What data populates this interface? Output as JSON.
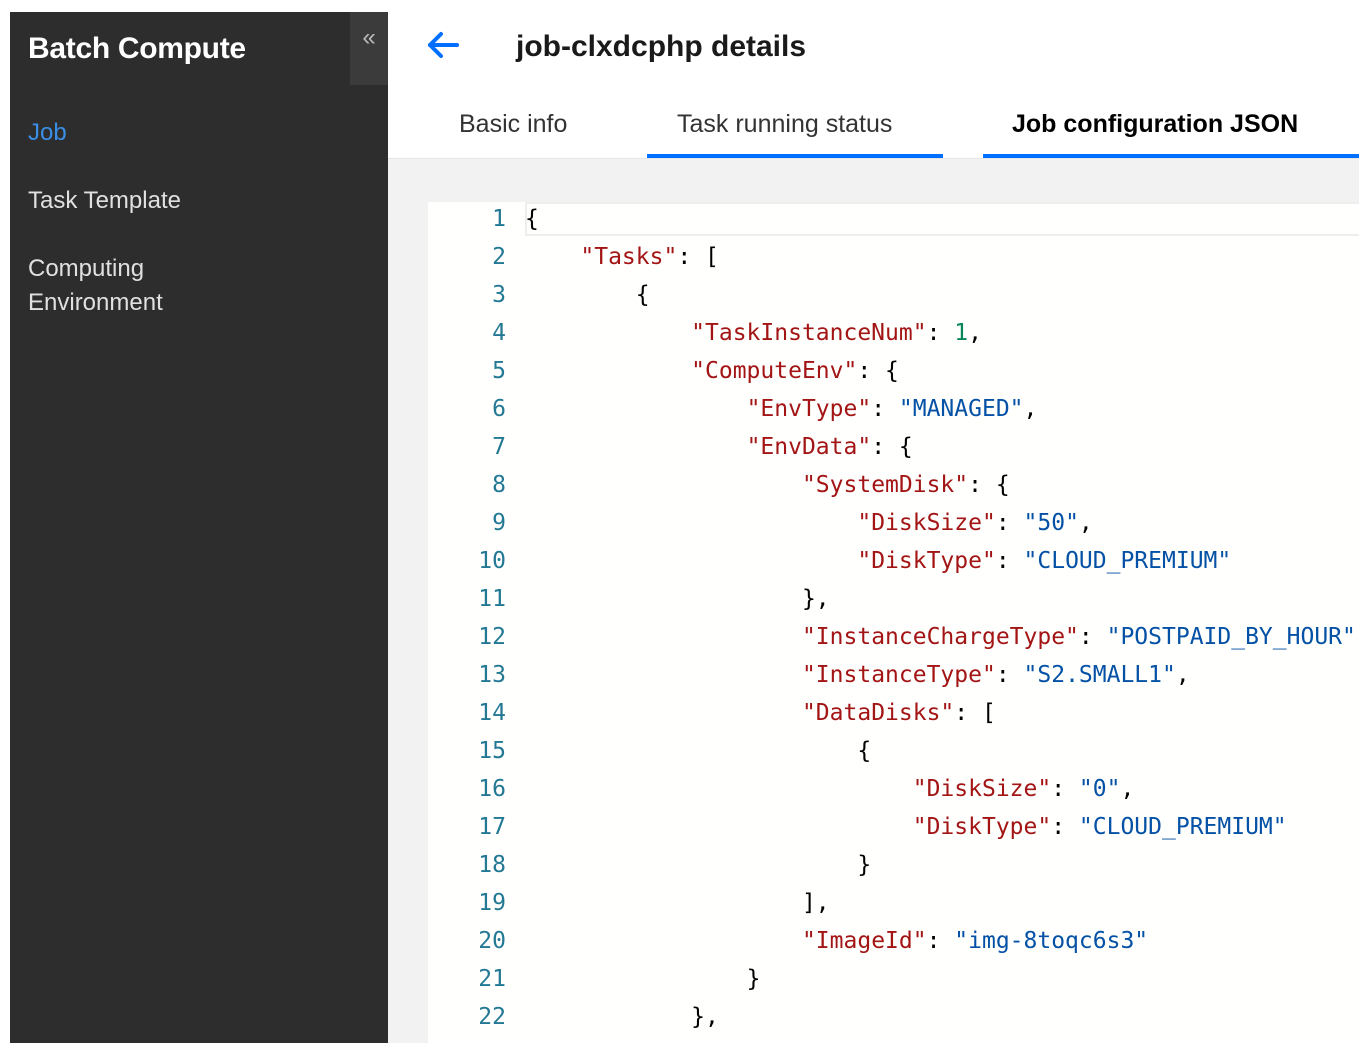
{
  "sidebar": {
    "brand": "Batch Compute",
    "collapse_icon": "«",
    "items": [
      {
        "label": "Job",
        "active": true
      },
      {
        "label": "Task Template",
        "active": false
      },
      {
        "label": "Computing",
        "active": false
      },
      {
        "label": "Environment",
        "active": false
      }
    ]
  },
  "header": {
    "back_icon": "arrow-left-icon",
    "title": "job-clxdcphp details"
  },
  "tabs": [
    {
      "label": "Basic info"
    },
    {
      "label": "Task running status"
    },
    {
      "label": "Job configuration JSON",
      "selected": true
    }
  ],
  "colors": {
    "accent": "#006eff",
    "sidebar_bg": "#2d2d2d",
    "active_nav": "#3a8ee6",
    "json_key": "#a31515",
    "json_string": "#0451a5",
    "json_number": "#098658",
    "line_number": "#237893"
  },
  "editor": {
    "lines": [
      {
        "n": "1",
        "indent": 0,
        "t": [
          [
            "p",
            "{"
          ]
        ]
      },
      {
        "n": "2",
        "indent": 1,
        "t": [
          [
            "k",
            "\"Tasks\""
          ],
          [
            "p",
            ": ["
          ]
        ]
      },
      {
        "n": "3",
        "indent": 2,
        "t": [
          [
            "p",
            "{"
          ]
        ]
      },
      {
        "n": "4",
        "indent": 3,
        "t": [
          [
            "k",
            "\"TaskInstanceNum\""
          ],
          [
            "p",
            ": "
          ],
          [
            "n",
            "1"
          ],
          [
            "p",
            ","
          ]
        ]
      },
      {
        "n": "5",
        "indent": 3,
        "t": [
          [
            "k",
            "\"ComputeEnv\""
          ],
          [
            "p",
            ": {"
          ]
        ]
      },
      {
        "n": "6",
        "indent": 4,
        "t": [
          [
            "k",
            "\"EnvType\""
          ],
          [
            "p",
            ": "
          ],
          [
            "s",
            "\"MANAGED\""
          ],
          [
            "p",
            ","
          ]
        ]
      },
      {
        "n": "7",
        "indent": 4,
        "t": [
          [
            "k",
            "\"EnvData\""
          ],
          [
            "p",
            ": {"
          ]
        ]
      },
      {
        "n": "8",
        "indent": 5,
        "t": [
          [
            "k",
            "\"SystemDisk\""
          ],
          [
            "p",
            ": {"
          ]
        ]
      },
      {
        "n": "9",
        "indent": 6,
        "t": [
          [
            "k",
            "\"DiskSize\""
          ],
          [
            "p",
            ": "
          ],
          [
            "s",
            "\"50\""
          ],
          [
            "p",
            ","
          ]
        ]
      },
      {
        "n": "10",
        "indent": 6,
        "t": [
          [
            "k",
            "\"DiskType\""
          ],
          [
            "p",
            ": "
          ],
          [
            "s",
            "\"CLOUD_PREMIUM\""
          ]
        ]
      },
      {
        "n": "11",
        "indent": 5,
        "t": [
          [
            "p",
            "},"
          ]
        ]
      },
      {
        "n": "12",
        "indent": 5,
        "t": [
          [
            "k",
            "\"InstanceChargeType\""
          ],
          [
            "p",
            ": "
          ],
          [
            "s",
            "\"POSTPAID_BY_HOUR\""
          ],
          [
            "p",
            ","
          ]
        ]
      },
      {
        "n": "13",
        "indent": 5,
        "t": [
          [
            "k",
            "\"InstanceType\""
          ],
          [
            "p",
            ": "
          ],
          [
            "s",
            "\"S2.SMALL1\""
          ],
          [
            "p",
            ","
          ]
        ]
      },
      {
        "n": "14",
        "indent": 5,
        "t": [
          [
            "k",
            "\"DataDisks\""
          ],
          [
            "p",
            ": ["
          ]
        ]
      },
      {
        "n": "15",
        "indent": 6,
        "t": [
          [
            "p",
            "{"
          ]
        ]
      },
      {
        "n": "16",
        "indent": 7,
        "t": [
          [
            "k",
            "\"DiskSize\""
          ],
          [
            "p",
            ": "
          ],
          [
            "s",
            "\"0\""
          ],
          [
            "p",
            ","
          ]
        ]
      },
      {
        "n": "17",
        "indent": 7,
        "t": [
          [
            "k",
            "\"DiskType\""
          ],
          [
            "p",
            ": "
          ],
          [
            "s",
            "\"CLOUD_PREMIUM\""
          ]
        ]
      },
      {
        "n": "18",
        "indent": 6,
        "t": [
          [
            "p",
            "}"
          ]
        ]
      },
      {
        "n": "19",
        "indent": 5,
        "t": [
          [
            "p",
            "],"
          ]
        ]
      },
      {
        "n": "20",
        "indent": 5,
        "t": [
          [
            "k",
            "\"ImageId\""
          ],
          [
            "p",
            ": "
          ],
          [
            "s",
            "\"img-8toqc6s3\""
          ]
        ]
      },
      {
        "n": "21",
        "indent": 4,
        "t": [
          [
            "p",
            "}"
          ]
        ]
      },
      {
        "n": "22",
        "indent": 3,
        "t": [
          [
            "p",
            "},"
          ]
        ]
      }
    ]
  }
}
